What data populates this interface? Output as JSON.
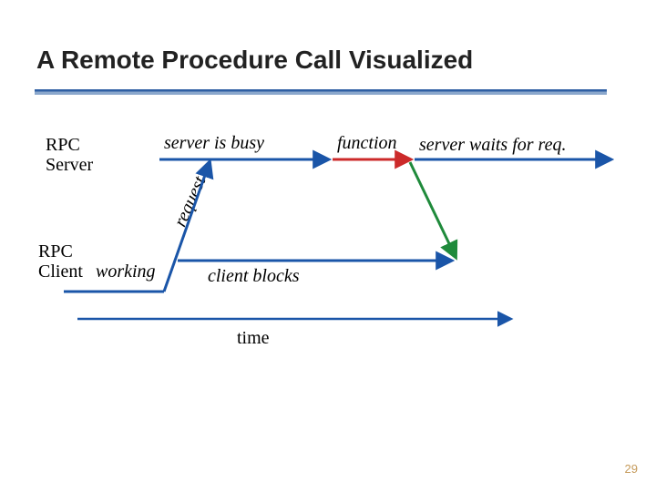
{
  "title": "A Remote Procedure Call Visualized",
  "labels": {
    "rpc_server": "RPC\nServer",
    "rpc_client": "RPC\nClient",
    "working": "working",
    "server_busy": "server is busy",
    "function": "function",
    "server_waits": "server waits for req.",
    "request": "request",
    "client_blocks": "client blocks",
    "time": "time"
  },
  "colors": {
    "arrow_blue": "#1a55a8",
    "arrow_red": "#cc2a2a",
    "arrow_green": "#1f8a3b",
    "rule_blue": "#2f5fa3"
  },
  "page_number": "29"
}
